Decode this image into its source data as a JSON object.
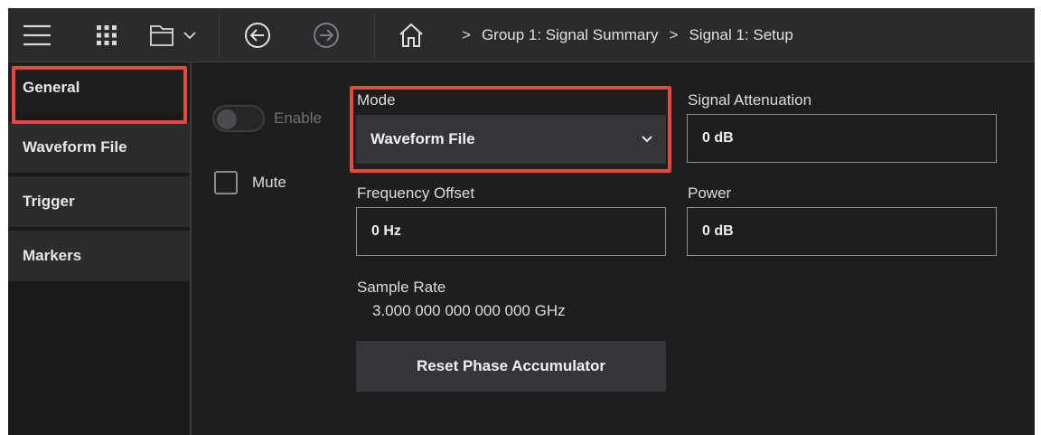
{
  "toolbar": {
    "icons": [
      "hamburger-menu-icon",
      "apps-grid-icon",
      "folder-icon",
      "chevron-down-icon",
      "back-arrow-icon",
      "forward-arrow-icon",
      "home-icon"
    ]
  },
  "breadcrumb": {
    "items": [
      "Group 1: Signal Summary",
      "Signal 1: Setup"
    ],
    "separator": ">"
  },
  "sidebar": {
    "items": [
      {
        "label": "General",
        "active": true
      },
      {
        "label": "Waveform File"
      },
      {
        "label": "Trigger"
      },
      {
        "label": "Markers"
      }
    ]
  },
  "enable": {
    "label": "Enable",
    "state": "off",
    "disabled": true
  },
  "mute": {
    "label": "Mute",
    "checked": false
  },
  "mode": {
    "label": "Mode",
    "value": "Waveform File"
  },
  "signal_attenuation": {
    "label": "Signal Attenuation",
    "value": "0 dB"
  },
  "frequency_offset": {
    "label": "Frequency Offset",
    "value": "0 Hz"
  },
  "power": {
    "label": "Power",
    "value": "0 dB"
  },
  "sample_rate": {
    "label": "Sample Rate",
    "value": "3.000 000 000 000 000 GHz"
  },
  "reset_button": {
    "label": "Reset Phase Accumulator"
  },
  "colors": {
    "highlight": "#e04a3f",
    "background": "#1e1e1f",
    "topbar": "#2a2b2d",
    "sidebar_item": "#2b2c2e"
  }
}
